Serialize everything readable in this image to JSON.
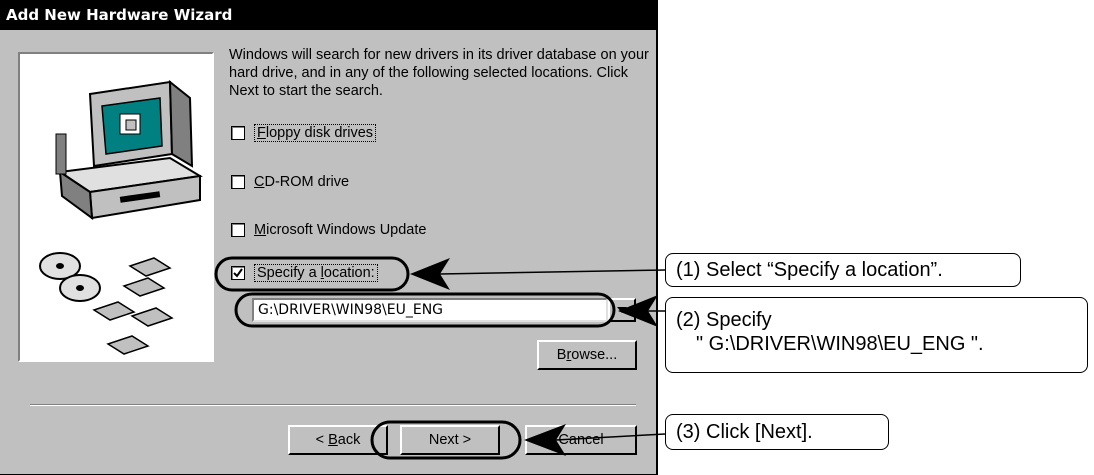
{
  "window": {
    "title": "Add New Hardware Wizard"
  },
  "intro_text": "Windows will search for new drivers in its driver database on your hard drive, and in any of the following selected locations. Click Next to start the search.",
  "options": [
    {
      "prefix": "",
      "hot": "F",
      "rest": "loppy disk drives",
      "checked": false
    },
    {
      "prefix": "",
      "hot": "C",
      "rest": "D-ROM drive",
      "checked": false
    },
    {
      "prefix": "",
      "hot": "M",
      "rest": "icrosoft Windows Update",
      "checked": false
    },
    {
      "prefix": "Specify a ",
      "hot": "l",
      "rest": "ocation:",
      "checked": true
    }
  ],
  "location_value": "G:\\DRIVER\\WIN98\\EU_ENG",
  "buttons": {
    "browse": {
      "pre": "B",
      "hot": "r",
      "post": "owse..."
    },
    "back": {
      "pre": "< ",
      "hot": "B",
      "post": "ack"
    },
    "next": "Next >",
    "cancel": "Cancel"
  },
  "callouts": {
    "step1": "(1) Select “Specify a location”.",
    "step2_line1": "(2) Specify",
    "step2_line2": "\" G:\\DRIVER\\WIN98\\EU_ENG \".",
    "step3": "(3) Click [Next]."
  }
}
